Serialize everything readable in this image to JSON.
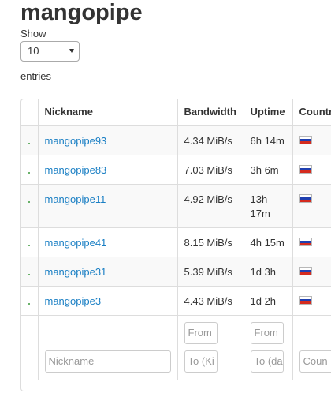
{
  "page": {
    "title": "mangopipe"
  },
  "length_menu": {
    "show_label": "Show",
    "selected": "10",
    "entries_label": "entries"
  },
  "table": {
    "headers": {
      "status": "",
      "nickname": "Nickname",
      "bandwidth": "Bandwidth",
      "uptime": "Uptime",
      "country": "Country"
    },
    "rows": [
      {
        "nickname": "mangopipe93",
        "bandwidth": "4.34 MiB/s",
        "uptime": "6h 14m",
        "flag": "russia-flag-icon"
      },
      {
        "nickname": "mangopipe83",
        "bandwidth": "7.03 MiB/s",
        "uptime": "3h 6m",
        "flag": "russia-flag-icon"
      },
      {
        "nickname": "mangopipe11",
        "bandwidth": "4.92 MiB/s",
        "uptime": "13h 17m",
        "flag": "russia-flag-icon"
      },
      {
        "nickname": "mangopipe41",
        "bandwidth": "8.15 MiB/s",
        "uptime": "4h 15m",
        "flag": "russia-flag-icon"
      },
      {
        "nickname": "mangopipe31",
        "bandwidth": "5.39 MiB/s",
        "uptime": "1d 3h",
        "flag": "russia-flag-icon"
      },
      {
        "nickname": "mangopipe3",
        "bandwidth": "4.43 MiB/s",
        "uptime": "1d 2h",
        "flag": "russia-flag-icon"
      }
    ],
    "filters": {
      "nickname_placeholder": "Nickname",
      "bandwidth_from": "From",
      "bandwidth_to": "To (Ki",
      "uptime_from": "From",
      "uptime_to": "To (da",
      "country_placeholder": "Coun"
    }
  },
  "colors": {
    "link": "#1a7fc4",
    "status_dot": "#3c9a3c",
    "border": "#dddddd",
    "stripe": "#f9f9f9"
  }
}
